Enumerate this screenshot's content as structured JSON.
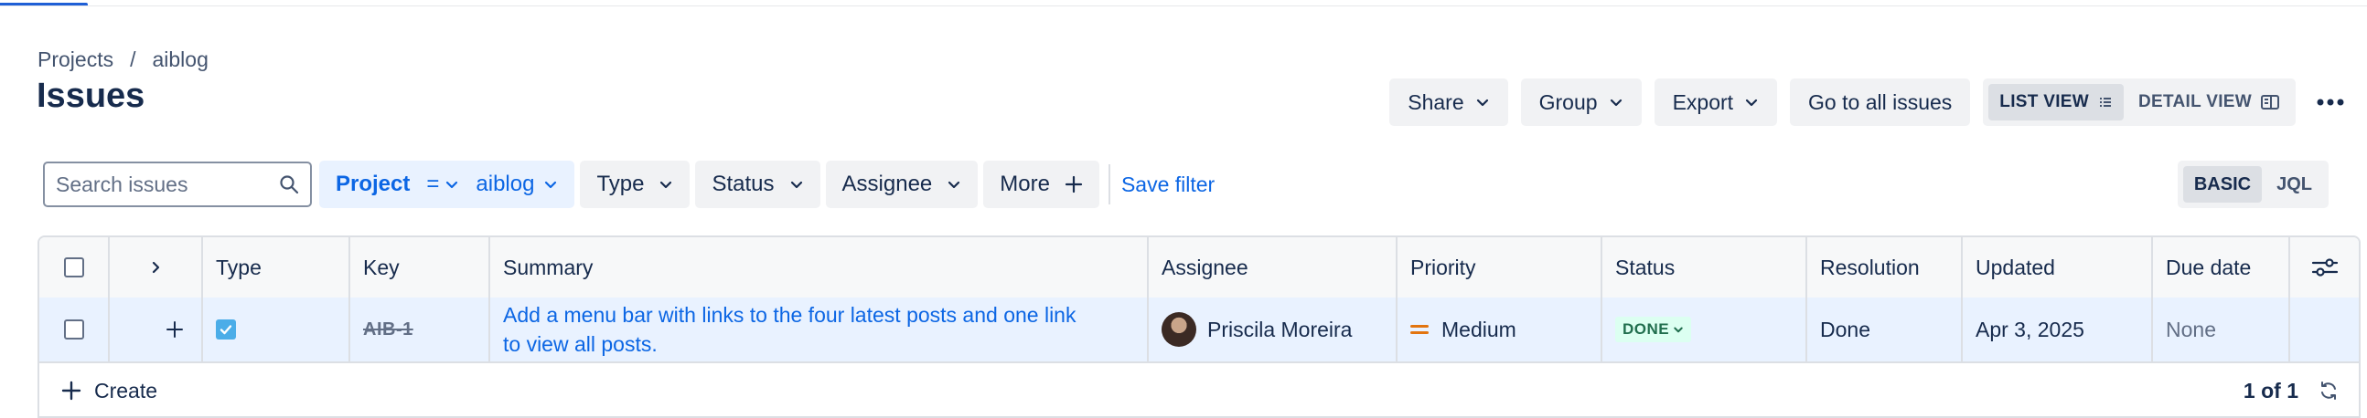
{
  "breadcrumb": {
    "project_root": "Projects",
    "separator": "/",
    "project": "aiblog"
  },
  "page": {
    "title": "Issues"
  },
  "toolbar": {
    "share": "Share",
    "group": "Group",
    "export": "Export",
    "go_to_all": "Go to all issues",
    "list_view": "LIST VIEW",
    "detail_view": "DETAIL VIEW"
  },
  "filters": {
    "search_placeholder": "Search issues",
    "project_label": "Project",
    "project_operator": "=",
    "project_value": "aiblog",
    "type": "Type",
    "status": "Status",
    "assignee": "Assignee",
    "more": "More",
    "save_filter": "Save filter",
    "basic": "BASIC",
    "jql": "JQL"
  },
  "table": {
    "columns": [
      "Type",
      "Key",
      "Summary",
      "Assignee",
      "Priority",
      "Status",
      "Resolution",
      "Updated",
      "Due date"
    ],
    "rows": [
      {
        "key": "AIB-1",
        "summary": "Add a menu bar with links to the four latest posts and one link to view all posts.",
        "assignee": "Priscila Moreira",
        "priority": "Medium",
        "status": "DONE",
        "resolution": "Done",
        "updated": "Apr 3, 2025",
        "due_date": "None"
      }
    ]
  },
  "footer": {
    "create": "Create",
    "pagination": "1 of 1"
  },
  "colors": {
    "accent": "#0c66e4",
    "priority_medium": "#e2740f",
    "status_done_bg": "#dcfff1",
    "status_done_fg": "#216e4e"
  }
}
